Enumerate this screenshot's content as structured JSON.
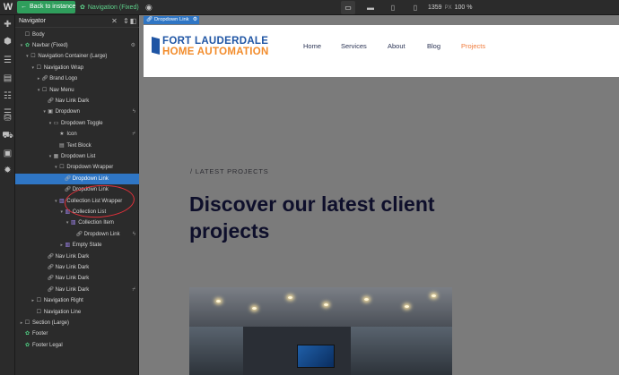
{
  "app": {
    "logo": "W"
  },
  "topbar": {
    "back_label": "Back to instance",
    "symbol_crumb": "Navigation (Fixed)",
    "width_value": "1359",
    "width_unit": "PX",
    "zoom": "100 %"
  },
  "navigator": {
    "title": "Navigator",
    "items": [
      {
        "label": "Body",
        "depth": 0,
        "caret": "",
        "icon": "box"
      },
      {
        "label": "Navbar (Fixed)",
        "depth": 0,
        "caret": "▾",
        "icon": "symbol",
        "right": "gear"
      },
      {
        "label": "Navigation Container (Large)",
        "depth": 1,
        "caret": "▾",
        "icon": "box"
      },
      {
        "label": "Navigation Wrap",
        "depth": 2,
        "caret": "▾",
        "icon": "box"
      },
      {
        "label": "Brand Logo",
        "depth": 3,
        "caret": "▸",
        "icon": "link"
      },
      {
        "label": "Nav Menu",
        "depth": 3,
        "caret": "▾",
        "icon": "box"
      },
      {
        "label": "Nav Link Dark",
        "depth": 4,
        "caret": "",
        "icon": "link"
      },
      {
        "label": "Dropdown",
        "depth": 4,
        "caret": "▾",
        "icon": "dropdown",
        "right": "bolt"
      },
      {
        "label": "Dropdown Toggle",
        "depth": 5,
        "caret": "▾",
        "icon": "toggle"
      },
      {
        "label": "Icon",
        "depth": 6,
        "caret": "",
        "icon": "star",
        "right": "unlink"
      },
      {
        "label": "Text Block",
        "depth": 6,
        "caret": "",
        "icon": "text"
      },
      {
        "label": "Dropdown List",
        "depth": 5,
        "caret": "▾",
        "icon": "list"
      },
      {
        "label": "Dropdown Wrapper",
        "depth": 6,
        "caret": "▾",
        "icon": "box"
      },
      {
        "label": "Dropdown Link",
        "depth": 7,
        "caret": "",
        "icon": "link",
        "selected": true
      },
      {
        "label": "Dropdown Link",
        "depth": 7,
        "caret": "",
        "icon": "link"
      },
      {
        "label": "Collection List Wrapper",
        "depth": 6,
        "caret": "▾",
        "icon": "collection"
      },
      {
        "label": "Collection List",
        "depth": 7,
        "caret": "▾",
        "icon": "collection"
      },
      {
        "label": "Collection Item",
        "depth": 8,
        "caret": "▾",
        "icon": "collection"
      },
      {
        "label": "Dropdown Link",
        "depth": 9,
        "caret": "",
        "icon": "link",
        "right": "bolt"
      },
      {
        "label": "Empty State",
        "depth": 7,
        "caret": "▸",
        "icon": "collection"
      },
      {
        "label": "Nav Link Dark",
        "depth": 4,
        "caret": "",
        "icon": "link"
      },
      {
        "label": "Nav Link Dark",
        "depth": 4,
        "caret": "",
        "icon": "link"
      },
      {
        "label": "Nav Link Dark",
        "depth": 4,
        "caret": "",
        "icon": "link"
      },
      {
        "label": "Nav Link Dark",
        "depth": 4,
        "caret": "",
        "icon": "link",
        "right": "unlink"
      },
      {
        "label": "Navigation Right",
        "depth": 2,
        "caret": "▸",
        "icon": "box"
      },
      {
        "label": "Navigation Line",
        "depth": 2,
        "caret": "",
        "icon": "box"
      },
      {
        "label": "Section (Large)",
        "depth": 0,
        "caret": "▸",
        "icon": "box"
      },
      {
        "label": "Footer",
        "depth": 0,
        "caret": "",
        "icon": "symbol"
      },
      {
        "label": "Footer Legal",
        "depth": 0,
        "caret": "",
        "icon": "symbol"
      }
    ]
  },
  "canvas": {
    "selection_label": "Dropdown Link",
    "brand": {
      "line1": "FORT LAUDERDALE",
      "line2": "HOME AUTOMATION"
    },
    "menu": [
      {
        "label": "Home",
        "active": false
      },
      {
        "label": "Services",
        "active": false
      },
      {
        "label": "About",
        "active": false
      },
      {
        "label": "Blog",
        "active": false
      },
      {
        "label": "Projects",
        "active": true
      }
    ],
    "eyebrow": "/ LATEST PROJECTS",
    "headline": "Discover our latest client projects"
  },
  "colors": {
    "accent": "#2f76c5",
    "green": "#2f9e5c",
    "brand_blue": "#1f55a4",
    "brand_orange": "#f28b2a",
    "active_link": "#f07a3a"
  }
}
